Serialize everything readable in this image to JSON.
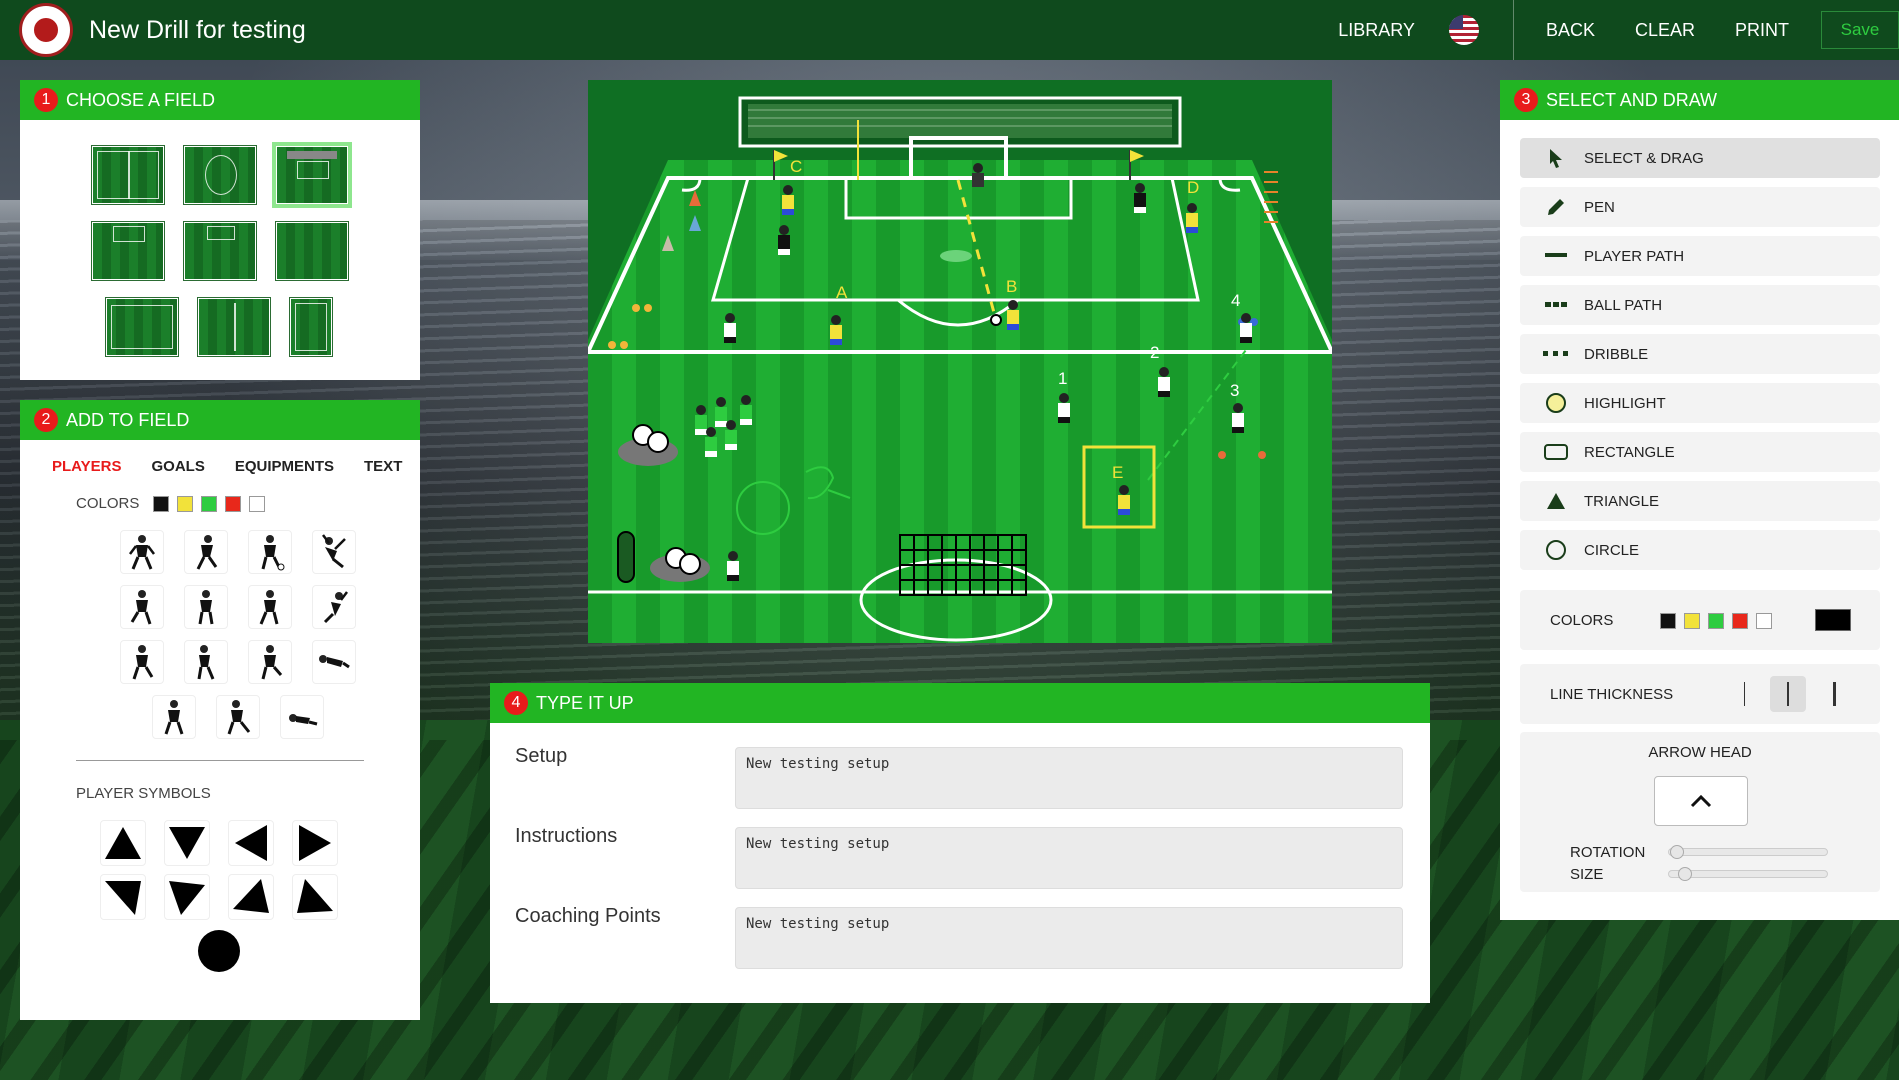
{
  "app": {
    "title": "New Drill for testing"
  },
  "nav": {
    "library": "LIBRARY",
    "back": "BACK",
    "clear": "CLEAR",
    "print": "PRINT",
    "save": "Save"
  },
  "choose_field": {
    "step": "1",
    "title": "CHOOSE A FIELD"
  },
  "add_field": {
    "step": "2",
    "title": "ADD TO FIELD",
    "tabs": [
      "PLAYERS",
      "GOALS",
      "EQUIPMENTS",
      "TEXT"
    ],
    "colors_label": "COLORS",
    "colors": [
      "#111111",
      "#f2e23a",
      "#2ecc40",
      "#e8281b",
      "#ffffff"
    ],
    "symbols_label": "PLAYER SYMBOLS"
  },
  "field": {
    "labels": {
      "c": "C",
      "d": "D",
      "a": "A",
      "b": "B",
      "e": "E",
      "n1": "1",
      "n2": "2",
      "n3": "3",
      "n4": "4"
    }
  },
  "type_up": {
    "step": "4",
    "title": "TYPE IT UP",
    "setup_label": "Setup",
    "setup_value": "New testing setup",
    "instructions_label": "Instructions",
    "instructions_value": "New testing setup",
    "coaching_label": "Coaching Points",
    "coaching_value": "New testing setup"
  },
  "select_draw": {
    "step": "3",
    "title": "SELECT AND DRAW",
    "tools": [
      "SELECT & DRAG",
      "PEN",
      "PLAYER PATH",
      "BALL PATH",
      "DRIBBLE",
      "HIGHLIGHT",
      "RECTANGLE",
      "TRIANGLE",
      "CIRCLE"
    ],
    "colors_label": "COLORS",
    "colors": [
      "#111111",
      "#f2e23a",
      "#2ecc40",
      "#e8281b",
      "#ffffff"
    ],
    "current_color": "#000000",
    "line_thickness_label": "LINE THICKNESS",
    "arrow_head_label": "ARROW HEAD",
    "rotation_label": "ROTATION",
    "size_label": "SIZE"
  },
  "colors": {
    "header_green": "#22b523",
    "topbar": "#0f4a1d",
    "step_red": "#e81b1b"
  }
}
